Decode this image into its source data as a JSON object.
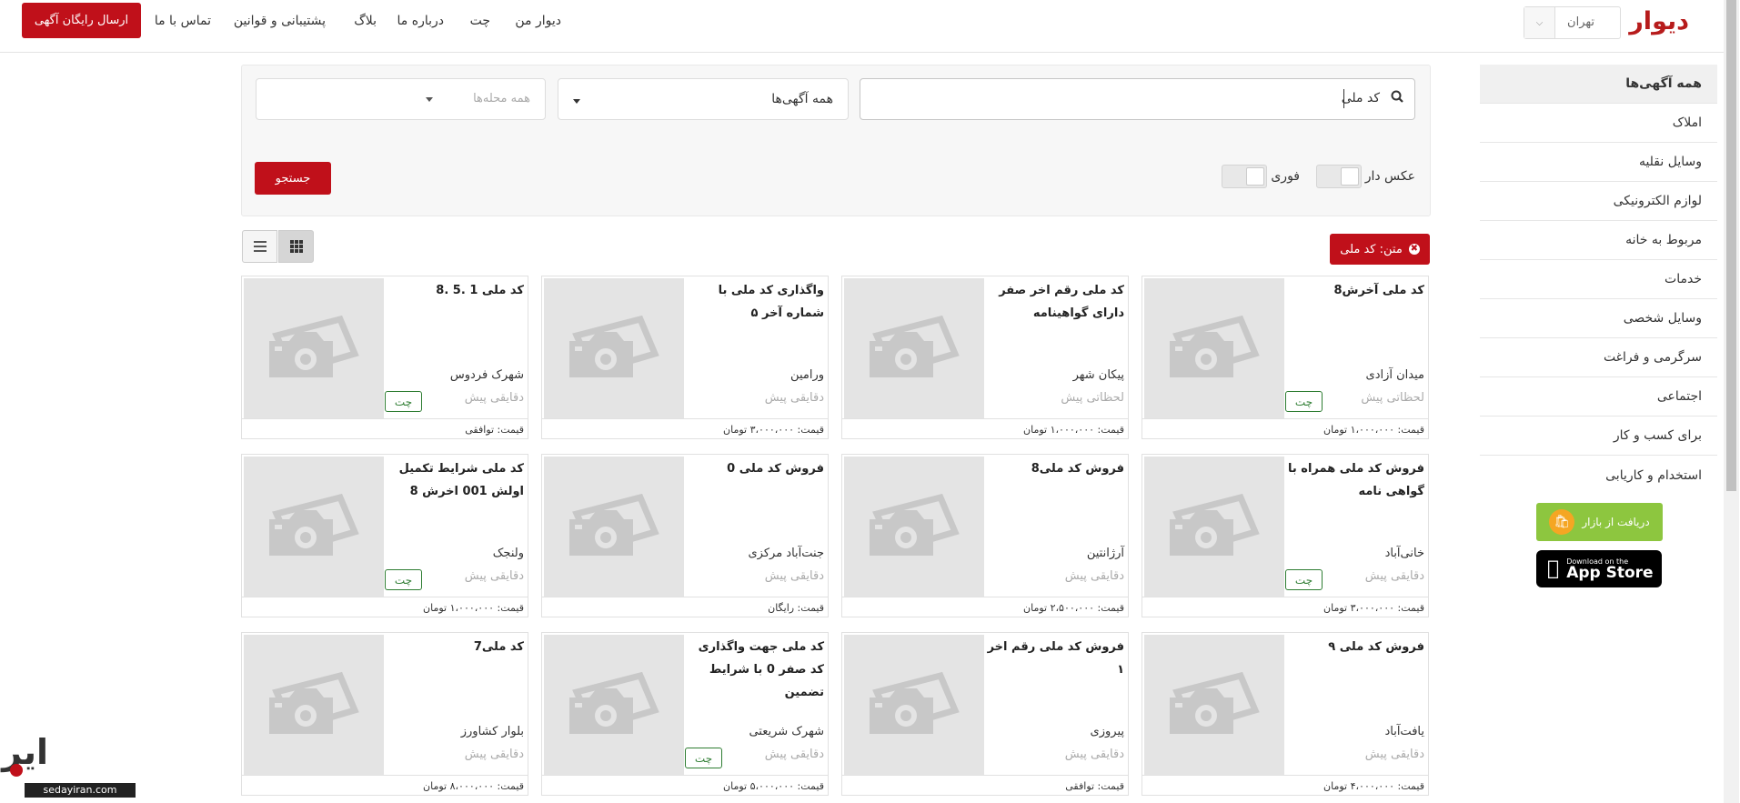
{
  "header": {
    "logo": "دیوار",
    "city": "تهران",
    "nav": [
      "دیوار من",
      "چت",
      "درباره ما",
      "بلاگ",
      "پشتیبانی و قوانین",
      "تماس با ما"
    ],
    "post_button": "ارسال رایگان آگهی"
  },
  "sidebar": {
    "categories": [
      "همه آگهی‌ها",
      "املاک",
      "وسایل نقلیه",
      "لوازم الکترونیکی",
      "مربوط به خانه",
      "خدمات",
      "وسایل شخصی",
      "سرگرمی و فراغت",
      "اجتماعی",
      "برای کسب و کار",
      "استخدام و کاریابی"
    ],
    "bazaar_label": "دریافت از بازار",
    "appstore_small": "Download on the",
    "appstore_big": "App Store"
  },
  "search": {
    "query": "کد ملی",
    "category": "همه آگهی‌ها",
    "neighborhood_placeholder": "همه محله‌ها",
    "photo_toggle": "عکس دار",
    "urgent_toggle": "فوری",
    "search_button": "جستجو"
  },
  "filter_chip": "متن: کد ملی",
  "cards": [
    {
      "title": "کد ملی آخرش8",
      "location": "میدان آزادی",
      "time": "لحظاتی پیش",
      "price": "قیمت: ۱،۰۰۰،۰۰۰ تومان",
      "chat": "چت"
    },
    {
      "title": "کد ملی رقم اخر صفر دارای گواهینامه",
      "location": "پیکان شهر",
      "time": "لحظاتی پیش",
      "price": "قیمت: ۱،۰۰۰،۰۰۰ تومان",
      "chat": ""
    },
    {
      "title": "واگذاری کد ملی با شماره آخر ۵",
      "location": "ورامین",
      "time": "دقایقی پیش",
      "price": "قیمت: ۳،۰۰۰،۰۰۰ تومان",
      "chat": ""
    },
    {
      "title": "کد ملی 1 .5 .8",
      "location": "شهرک فردوس",
      "time": "دقایقی پیش",
      "price": "قیمت: توافقی",
      "chat": "چت"
    },
    {
      "title": "فروش کد ملی همراه با گواهی نامه",
      "location": "خانی‌آباد",
      "time": "دقایقی پیش",
      "price": "قیمت: ۳،۰۰۰،۰۰۰ تومان",
      "chat": "چت"
    },
    {
      "title": "فروش کد ملی8",
      "location": "آرژانتین",
      "time": "دقایقی پیش",
      "price": "قیمت: ۲،۵۰۰،۰۰۰ تومان",
      "chat": ""
    },
    {
      "title": "فروش کد ملی 0",
      "location": "جنت‌آباد مرکزی",
      "time": "دقایقی پیش",
      "price": "قیمت: رایگان",
      "chat": ""
    },
    {
      "title": "کد ملی شرایط تکمیل اولش 001 اخرش 8",
      "location": "ولنجک",
      "time": "دقایقی پیش",
      "price": "قیمت: ۱،۰۰۰،۰۰۰ تومان",
      "chat": "چت"
    },
    {
      "title": "فروش کد ملی ۹",
      "location": "یافت‌آباد",
      "time": "دقایقی پیش",
      "price": "قیمت: ۴،۰۰۰،۰۰۰ تومان",
      "chat": ""
    },
    {
      "title": "فروش کد ملی رقم اخر ۱",
      "location": "پیروزی",
      "time": "دقایقی پیش",
      "price": "قیمت: توافقی",
      "chat": ""
    },
    {
      "title": "کد ملی جهت واگذاری کد صفر 0 با شرایط تضمین",
      "location": "شهرک شریعتی",
      "time": "دقایقی پیش",
      "price": "قیمت: ۵،۰۰۰،۰۰۰ تومان",
      "chat": "چت"
    },
    {
      "title": "کد ملی7",
      "location": "بلوار کشاورز",
      "time": "دقایقی پیش",
      "price": "قیمت: ۸،۰۰۰،۰۰۰ تومان",
      "chat": ""
    }
  ],
  "watermark": {
    "mark": "ایرانی",
    "site": "sedayiran.com"
  },
  "colors": {
    "brand_red": "#c0101a",
    "chat_green": "#2e7d32"
  }
}
